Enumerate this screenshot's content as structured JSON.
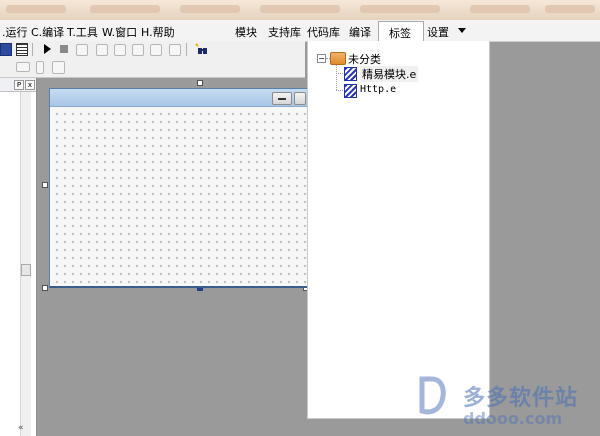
{
  "menubar": {
    "items": [
      {
        "label": ".运行"
      },
      {
        "label": "C.编译"
      },
      {
        "label": "T.工具"
      },
      {
        "label": "W.窗口"
      },
      {
        "label": "H.帮助"
      }
    ],
    "tabs": [
      {
        "label": "模块"
      },
      {
        "label": "支持库"
      },
      {
        "label": "代码库"
      },
      {
        "label": "编译"
      },
      {
        "label": "标签"
      },
      {
        "label": "设置"
      }
    ],
    "active_tab": "标签"
  },
  "left_panel": {
    "pin_glyph": "P",
    "close_glyph": "x",
    "bottom_glyph": "«"
  },
  "tree": {
    "root": {
      "label": "未分类",
      "toggle": "−"
    },
    "children": [
      {
        "label": "精易模块.e"
      },
      {
        "label": "Http.e"
      }
    ]
  },
  "watermark": {
    "title": "多多软件站",
    "url": "ddooo.com"
  },
  "colors": {
    "background": "#9a9a9a",
    "form_title": "#b8d2ee",
    "folder": "#e89a3c",
    "file": "#2a37c5",
    "watermark": "#4a6fb6"
  }
}
